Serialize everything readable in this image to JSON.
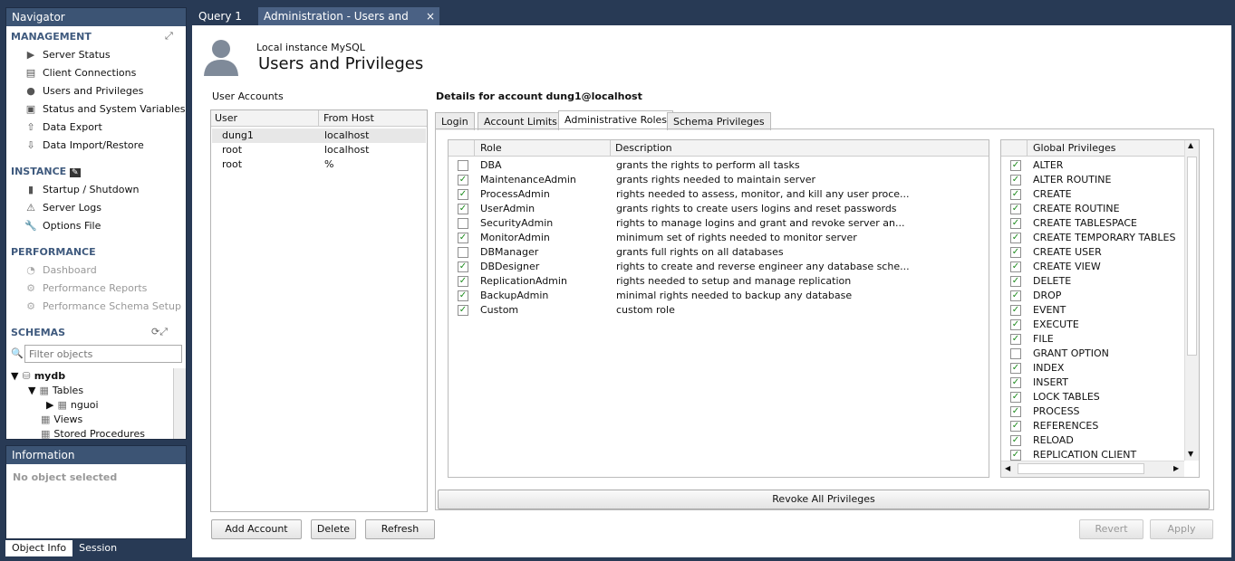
{
  "navigator": {
    "title": "Navigator",
    "management": {
      "label": "MANAGEMENT",
      "items": [
        "Server Status",
        "Client Connections",
        "Users and Privileges",
        "Status and System Variables",
        "Data Export",
        "Data Import/Restore"
      ]
    },
    "instance": {
      "label": "INSTANCE",
      "items": [
        "Startup / Shutdown",
        "Server Logs",
        "Options File"
      ]
    },
    "performance": {
      "label": "PERFORMANCE",
      "items": [
        "Dashboard",
        "Performance Reports",
        "Performance Schema Setup"
      ]
    },
    "schemas": {
      "label": "SCHEMAS",
      "filter_placeholder": "Filter objects",
      "db": "mydb",
      "tables": "Tables",
      "table1": "nguoi",
      "views": "Views",
      "procs": "Stored Procedures"
    }
  },
  "info": {
    "title": "Information",
    "text": "No object selected",
    "tabs": [
      "Object Info",
      "Session"
    ]
  },
  "tabs": {
    "query": "Query 1",
    "admin": "Administration - Users and Privil...",
    "close": "×"
  },
  "header": {
    "instance": "Local instance MySQL",
    "title": "Users and Privileges"
  },
  "accounts": {
    "label": "User Accounts",
    "col_user": "User",
    "col_host": "From Host",
    "rows": [
      {
        "user": "dung1",
        "host": "localhost"
      },
      {
        "user": "root",
        "host": "localhost"
      },
      {
        "user": "root",
        "host": "%"
      }
    ]
  },
  "details": {
    "title": "Details for account dung1@localhost",
    "tabs": [
      "Login",
      "Account Limits",
      "Administrative Roles",
      "Schema Privileges"
    ],
    "col_role": "Role",
    "col_desc": "Description",
    "roles": [
      {
        "name": "DBA",
        "desc": "grants the rights to perform all tasks",
        "checked": false
      },
      {
        "name": "MaintenanceAdmin",
        "desc": "grants rights needed to maintain server",
        "checked": true
      },
      {
        "name": "ProcessAdmin",
        "desc": "rights needed to assess, monitor, and kill any user proce...",
        "checked": true
      },
      {
        "name": "UserAdmin",
        "desc": "grants rights to create users logins and reset passwords",
        "checked": true
      },
      {
        "name": "SecurityAdmin",
        "desc": "rights to manage logins and grant and revoke server an...",
        "checked": false
      },
      {
        "name": "MonitorAdmin",
        "desc": "minimum set of rights needed to monitor server",
        "checked": true
      },
      {
        "name": "DBManager",
        "desc": "grants full rights on all databases",
        "checked": false
      },
      {
        "name": "DBDesigner",
        "desc": "rights to create and reverse engineer any database sche...",
        "checked": true
      },
      {
        "name": "ReplicationAdmin",
        "desc": "rights needed to setup and manage replication",
        "checked": true
      },
      {
        "name": "BackupAdmin",
        "desc": "minimal rights needed to backup any database",
        "checked": true
      },
      {
        "name": "Custom",
        "desc": "custom role",
        "checked": true
      }
    ],
    "col_global": "Global Privileges",
    "privileges": [
      {
        "name": "ALTER",
        "checked": true
      },
      {
        "name": "ALTER ROUTINE",
        "checked": true
      },
      {
        "name": "CREATE",
        "checked": true
      },
      {
        "name": "CREATE ROUTINE",
        "checked": true
      },
      {
        "name": "CREATE TABLESPACE",
        "checked": true
      },
      {
        "name": "CREATE TEMPORARY TABLES",
        "checked": true
      },
      {
        "name": "CREATE USER",
        "checked": true
      },
      {
        "name": "CREATE VIEW",
        "checked": true
      },
      {
        "name": "DELETE",
        "checked": true
      },
      {
        "name": "DROP",
        "checked": true
      },
      {
        "name": "EVENT",
        "checked": true
      },
      {
        "name": "EXECUTE",
        "checked": true
      },
      {
        "name": "FILE",
        "checked": true
      },
      {
        "name": "GRANT OPTION",
        "checked": false
      },
      {
        "name": "INDEX",
        "checked": true
      },
      {
        "name": "INSERT",
        "checked": true
      },
      {
        "name": "LOCK TABLES",
        "checked": true
      },
      {
        "name": "PROCESS",
        "checked": true
      },
      {
        "name": "REFERENCES",
        "checked": true
      },
      {
        "name": "RELOAD",
        "checked": true
      },
      {
        "name": "REPLICATION CLIENT",
        "checked": true
      }
    ],
    "revoke": "Revoke All Privileges"
  },
  "buttons": {
    "add": "Add Account",
    "delete": "Delete",
    "refresh": "Refresh",
    "revert": "Revert",
    "apply": "Apply"
  }
}
